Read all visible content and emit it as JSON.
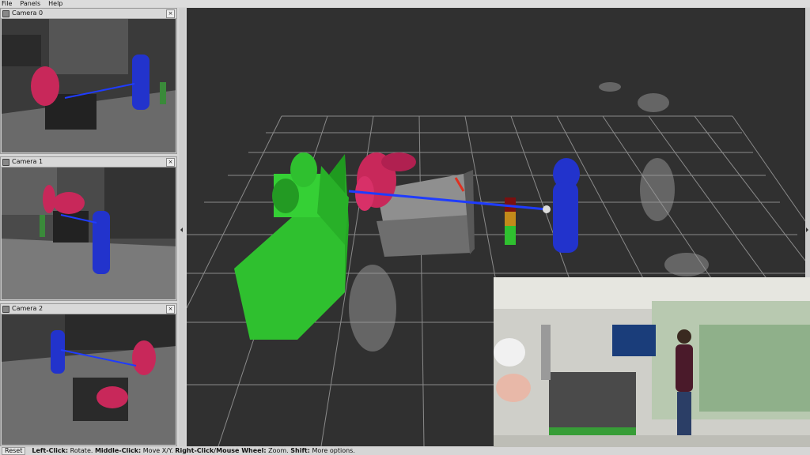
{
  "menu": {
    "file": "File",
    "panels": "Panels",
    "help": "Help"
  },
  "cameras": [
    {
      "title": "Camera 0",
      "close": "×"
    },
    {
      "title": "Camera 1",
      "close": "×"
    },
    {
      "title": "Camera 2",
      "close": "×"
    }
  ],
  "status": {
    "reset": "Reset",
    "hint_left": "Left-Click:",
    "hint_left_text": "Rotate.",
    "hint_middle": "Middle-Click:",
    "hint_middle_text": "Move X/Y.",
    "hint_right": "Right-Click/Mouse Wheel:",
    "hint_right_text": "Zoom.",
    "hint_shift": "Shift:",
    "hint_shift_text": "More options."
  },
  "colors": {
    "robot_red": "#c8285a",
    "human_blue": "#2233cc",
    "machine_green": "#2fc02f",
    "link_blue": "#1f3cff",
    "background_3d": "#303030"
  }
}
